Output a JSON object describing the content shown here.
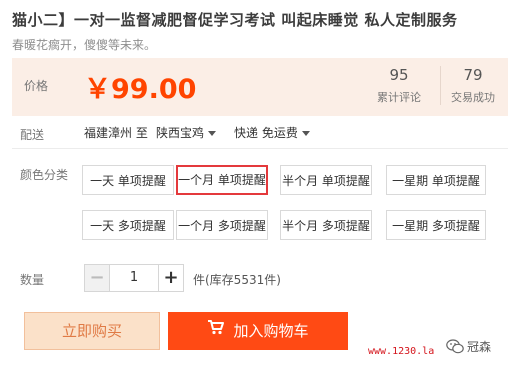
{
  "product": {
    "title": "猫小二】一对一监督减肥督促学习考试 叫起床睡觉 私人定制服务",
    "subtitle": "春暖花瘸开，傻傻等未来。"
  },
  "price": {
    "label": "价格",
    "value": "￥99.00",
    "stats": [
      {
        "num": "95",
        "label": "累计评论"
      },
      {
        "num": "79",
        "label": "交易成功"
      }
    ]
  },
  "shipping": {
    "label": "配送",
    "origin": "福建漳州 至",
    "destination": "陕西宝鸡",
    "method": "快递 免运费"
  },
  "variants": {
    "label": "颜色分类",
    "options": [
      "一天 单项提醒",
      "一个月 单项提醒",
      "半个月 单项提醒",
      "一星期 单项提醒",
      "一天 多项提醒",
      "一个月 多项提醒",
      "半个月 多项提醒",
      "一星期 多项提醒"
    ],
    "selected_index": 1
  },
  "quantity": {
    "label": "数量",
    "minus": "−",
    "plus": "+",
    "value": "1",
    "stock": "件(库存5531件)"
  },
  "actions": {
    "buy_now": "立即购买",
    "add_to_cart": "加入购物车"
  },
  "overlay": {
    "watermark": "www.1230.la",
    "wechat": "冠森"
  },
  "colors": {
    "price": "#ff4400",
    "cart_button": "#ff4a14",
    "buy_button_bg": "#fbe1c9",
    "selected_border": "#e4393c"
  }
}
